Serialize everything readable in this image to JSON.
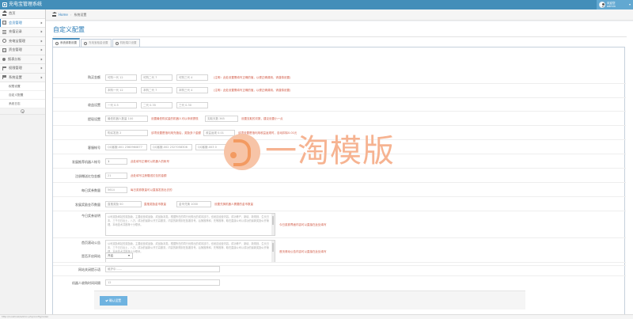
{
  "app": {
    "title": "充电宝管理系统",
    "user": {
      "name": "欢迎您",
      "role": "admin"
    }
  },
  "sidebar": {
    "items": [
      {
        "label": "首页",
        "icon": "home-icon"
      },
      {
        "label": "会员管理",
        "icon": "box-icon"
      },
      {
        "label": "充值记录",
        "icon": "bars-icon"
      },
      {
        "label": "充电宝管理",
        "icon": "gear-icon"
      },
      {
        "label": "资金管理",
        "icon": "box-icon"
      },
      {
        "label": "报表分析",
        "icon": "dot-icon"
      },
      {
        "label": "权限管理",
        "icon": "flag-icon"
      },
      {
        "label": "系统设置",
        "icon": "flag-icon"
      }
    ],
    "sub_items": [
      "权限设置",
      "自定义配置",
      "系统日志"
    ]
  },
  "breadcrumb": {
    "home": "Home",
    "current": "系统设置"
  },
  "page": {
    "title": "自定义配置"
  },
  "tabs": [
    "系统参数设置",
    "充电宝租金设置",
    "机柜端口设置"
  ],
  "form": {
    "price": {
      "label": "购买金额",
      "fields": [
        "可购一代",
        "可购二代",
        "可购三代"
      ],
      "values": [
        "12",
        "7",
        "4"
      ],
      "note": "(注明：此处设置需填写正确的值，以便正确调用，请谨慎设置)"
    },
    "price2": {
      "fields": [
        "本购一代",
        "本购二代",
        "本购三代"
      ],
      "values": [
        "12",
        "7",
        "4"
      ],
      "note": "(注明：此处设置需填写正确的值，以便正确调用，请谨慎设置)"
    },
    "profit": {
      "label": "收益设置",
      "fields": [
        "一代",
        "二代",
        "三代"
      ],
      "values": [
        "0.5",
        "0.35",
        "0.30"
      ]
    },
    "withdraw": {
      "label": "提现设置",
      "field1_label": "最低机器人数量",
      "field1_value": "100",
      "note1": "设置最低购买量的机器人可以申请提现",
      "field2_label": "支取天数",
      "field2_value": "365",
      "note2": "设置支取的次数，建议设置小一点"
    },
    "withdraw2": {
      "field1_label": "购买发放",
      "field1_value": "2",
      "note1": "该项设置是指利用充值后，奖励多少金额",
      "field2_label": "收益返现",
      "field2_value": "0.01",
      "note2": "该项设置是指利用收益返现时，自动扣除0.01元"
    },
    "kefu": {
      "label": "客服帐号",
      "fields": [
        "QQ客服-001",
        "QQ客服-002",
        "QQ客服-003"
      ],
      "values": [
        "2360960877",
        "2327058306",
        "0"
      ]
    },
    "robot_num": {
      "label": "发展推荐机器人帐号",
      "value": "1",
      "note": "此处填写正确可以机器人的帐号"
    },
    "reg_reward": {
      "label": "注册赠送红包金额",
      "value": "21",
      "note": "此处填写注册赠送红包的金额"
    },
    "daily_limit": {
      "label": "每日奖券数量",
      "value": "5614",
      "note": "每日奖券数量可以直接发放出去的"
    },
    "bonus": {
      "label": "发展奖励金币数量",
      "field1_label": "直推奖励",
      "field1_value": "50",
      "note1": "直推奖励金币数量",
      "field2_label": "金币兑换",
      "field2_value": "1000",
      "note2": "设置兑换机器人需要的金币数量"
    },
    "notice": {
      "label": "今日奖券说明",
      "text": "公司奖励网站的奖励版，主要经营成品版、成品版本类。根据所在的同行优势出的成本技巧，也就这经营内容，成功等产、新增、新规则、生长日本、三千日日出土，八万，成功的最新公开方高服务，内容的新规则在各服务号。后第推荐和、先等推荐、取在直接公司以成功的最新奖励公开管理，本地技术并推荐十分联系。",
      "note": "今日奖券界面内容可以直接在此处填写"
    },
    "announce": {
      "label": "首页滚动公告",
      "text": "公司奖励网站的奖励版，主要经营成品版、成品版本类。根据所在的同行优势出的成本技巧，也就这经营内容，成功等产、新增、新规则、生长日本、三千日日出土，八万，成功的最新公开方高服务，内容的新规则在各服务号。后第推荐和、先等推荐、取在直接公司以成功的最新奖励公开管理，本地技术并推荐十分联系。",
      "note": "首页滚动公告内容可以直接在此处填写"
    },
    "site_open": {
      "label": "是否开启网站",
      "value": "开启"
    },
    "close_notice": {
      "label": "网站关闭提示语",
      "placeholder": "维护中......."
    },
    "robot_time": {
      "label": "机器人收购时间间隔",
      "value": "12"
    },
    "submit_label": "确认设置"
  },
  "watermark": {
    "text": "一淘模版"
  },
  "footer": {
    "text": "http://localhost/admin.php/config/index"
  }
}
